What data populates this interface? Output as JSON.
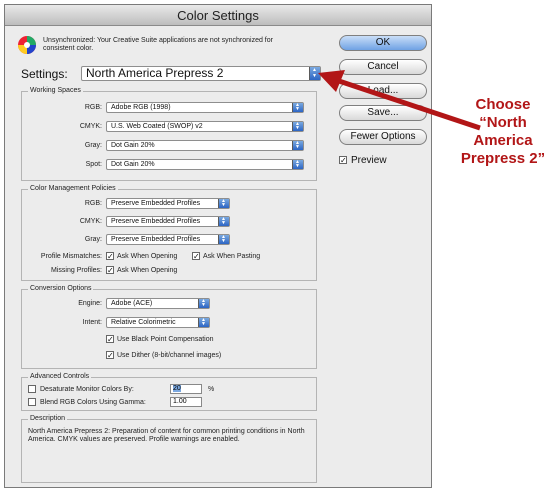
{
  "window": {
    "title": "Color Settings"
  },
  "sync_message": "Unsynchronized: Your Creative Suite applications are not synchronized for consistent color.",
  "settings": {
    "label": "Settings:",
    "value": "North America Prepress 2"
  },
  "working_spaces": {
    "title": "Working Spaces",
    "rows": [
      {
        "label": "RGB:",
        "value": "Adobe RGB (1998)"
      },
      {
        "label": "CMYK:",
        "value": "U.S. Web Coated (SWOP) v2"
      },
      {
        "label": "Gray:",
        "value": "Dot Gain 20%"
      },
      {
        "label": "Spot:",
        "value": "Dot Gain 20%"
      }
    ]
  },
  "policies": {
    "title": "Color Management Policies",
    "rows": [
      {
        "label": "RGB:",
        "value": "Preserve Embedded Profiles"
      },
      {
        "label": "CMYK:",
        "value": "Preserve Embedded Profiles"
      },
      {
        "label": "Gray:",
        "value": "Preserve Embedded Profiles"
      }
    ],
    "mismatch_label": "Profile Mismatches:",
    "ask_opening": "Ask When Opening",
    "ask_pasting": "Ask When Pasting",
    "missing_label": "Missing Profiles:",
    "missing_ask": "Ask When Opening"
  },
  "conversion": {
    "title": "Conversion Options",
    "engine_label": "Engine:",
    "engine_value": "Adobe (ACE)",
    "intent_label": "Intent:",
    "intent_value": "Relative Colorimetric",
    "black_point": "Use Black Point Compensation",
    "dither": "Use Dither (8-bit/channel images)"
  },
  "advanced": {
    "title": "Advanced Controls",
    "desaturate_label": "Desaturate Monitor Colors By:",
    "desaturate_value": "20",
    "desaturate_unit": "%",
    "blend_label": "Blend RGB Colors Using Gamma:",
    "blend_value": "1.00"
  },
  "description": {
    "title": "Description",
    "text": "North America Prepress 2:  Preparation of content for common printing conditions in North America. CMYK values are preserved. Profile warnings are enabled."
  },
  "buttons": {
    "ok": "OK",
    "cancel": "Cancel",
    "load": "Load...",
    "save": "Save...",
    "fewer": "Fewer Options",
    "preview": "Preview"
  },
  "annotation": {
    "text": "Choose “North America Prepress 2”",
    "color": "#b21617"
  }
}
